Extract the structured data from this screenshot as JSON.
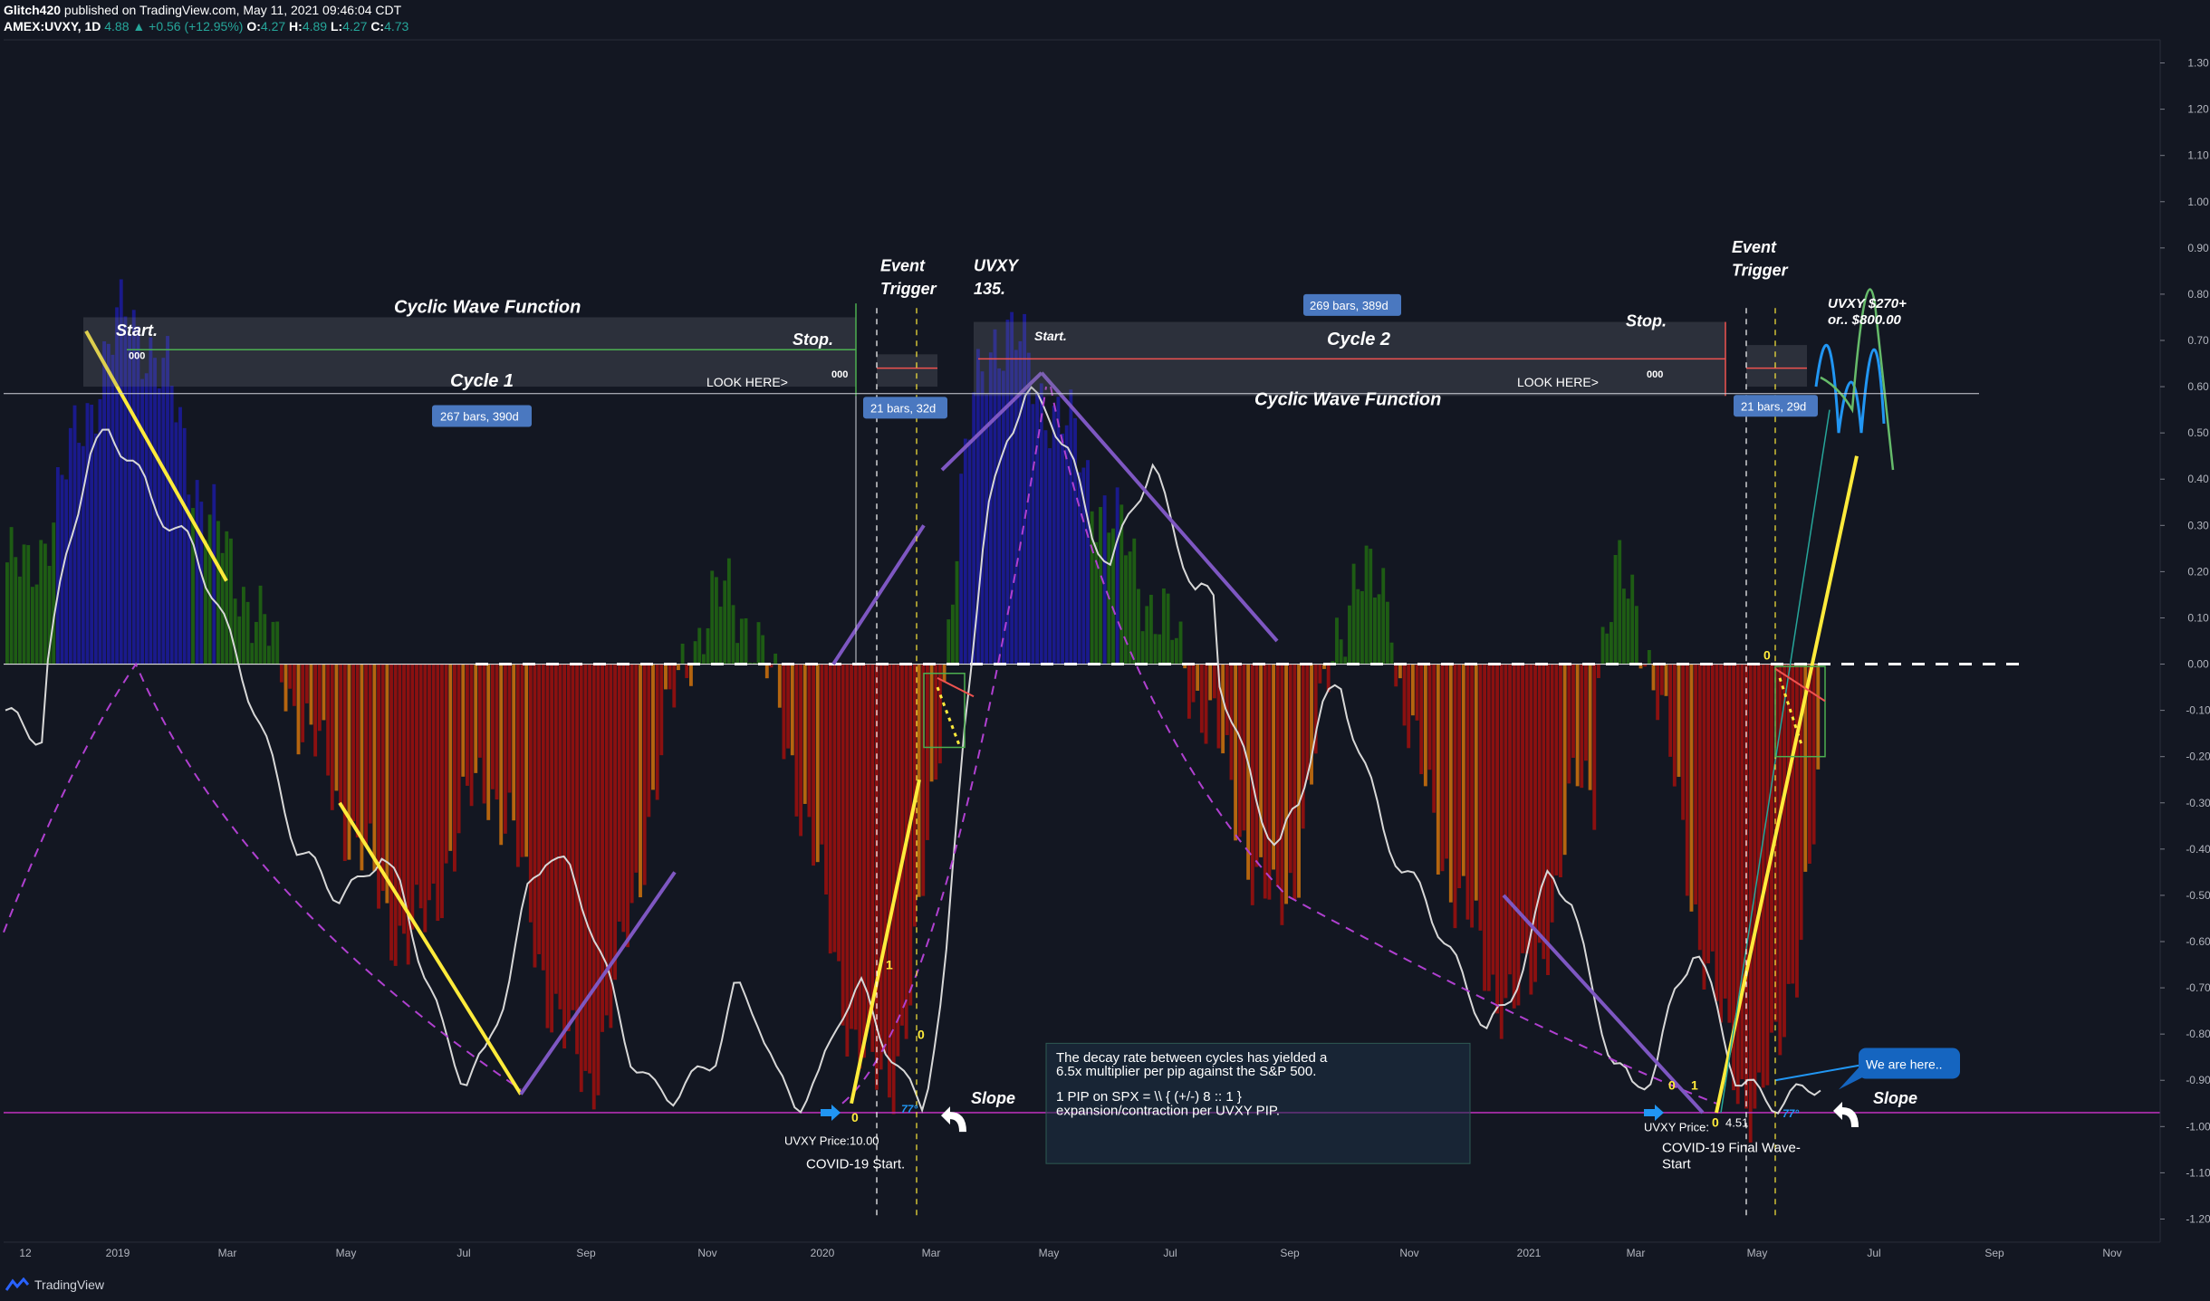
{
  "header": {
    "publisher": "Glitch420",
    "published_text": "published on TradingView.com, May 11, 2021 09:46:04 CDT",
    "symbol": "AMEX:UVXY, 1D",
    "last": "4.88",
    "change": "+0.56 (+12.95%)",
    "o_label": "O:",
    "o": "4.27",
    "h_label": "H:",
    "h": "4.89",
    "l_label": "L:",
    "l": "4.27",
    "c_label": "C:",
    "c": "4.73"
  },
  "footer": {
    "brand": "TradingView"
  },
  "colors": {
    "background": "#131722",
    "bull_strong": "#1a1a8c",
    "bull": "#1e5c14",
    "bear": "#8b1010",
    "bear_light": "#b5650f",
    "oscillator": "#d8d8d8",
    "trend_yellow": "#ffeb3b",
    "trend_purple": "#7e57c2",
    "arc_dashed": "#b040d0",
    "baseline": "#b32fb3",
    "label_blue": "#4a78c0"
  },
  "chart_data": {
    "type": "bar",
    "title": "",
    "ylim": [
      -1.25,
      1.35
    ],
    "y_ticks": [
      "1.30",
      "1.20",
      "1.10",
      "1.00",
      "0.90",
      "0.80",
      "0.70",
      "0.60",
      "0.50",
      "0.40",
      "0.30",
      "0.20",
      "0.10",
      "0.00",
      "-0.10",
      "-0.20",
      "-0.30",
      "-0.40",
      "-0.50",
      "-0.60",
      "-0.70",
      "-0.80",
      "-0.90",
      "-1.00",
      "-1.10",
      "-1.20"
    ],
    "x_ticks": [
      "12",
      "2019",
      "Mar",
      "May",
      "Jul",
      "Sep",
      "Nov",
      "2020",
      "Mar",
      "May",
      "Jul",
      "Sep",
      "Nov",
      "2021",
      "Mar",
      "May",
      "Jul",
      "Sep",
      "Nov"
    ],
    "series": [
      {
        "values": [
          0.22,
          0.18,
          0.3,
          0.42,
          0.55,
          0.68,
          0.75,
          0.7,
          0.6,
          0.45,
          0.32,
          0.22,
          0.15,
          0.05,
          -0.05,
          -0.15,
          -0.25,
          -0.35,
          -0.45,
          -0.55,
          -0.6,
          -0.55,
          -0.4,
          -0.3,
          -0.25,
          -0.35,
          -0.55,
          -0.72,
          -0.85,
          -0.9,
          -0.75,
          -0.55,
          -0.3,
          -0.1,
          0.05,
          0.12,
          0.15,
          0.08,
          -0.05,
          -0.2,
          -0.4,
          -0.6,
          -0.8,
          -0.9,
          -0.88,
          -0.7,
          -0.3,
          0.2,
          0.55,
          0.72,
          0.7,
          0.62,
          0.55,
          0.48,
          0.38,
          0.3,
          0.22,
          0.12,
          0.05,
          -0.05,
          -0.15,
          -0.3,
          -0.45,
          -0.55,
          -0.45,
          -0.2,
          0.05,
          0.2,
          0.15,
          0.0,
          -0.2,
          -0.35,
          -0.5,
          -0.6,
          -0.7,
          -0.75,
          -0.65,
          -0.5,
          -0.25,
          0.0,
          0.18,
          0.12,
          -0.05,
          -0.3,
          -0.55,
          -0.75,
          -0.9,
          -0.95,
          -0.85,
          -0.6,
          -0.3
        ]
      },
      {
        "values": [
          -0.1,
          -0.15,
          0.0,
          0.25,
          0.45,
          0.5,
          0.45,
          0.35,
          0.3,
          0.25,
          0.15,
          0.02,
          -0.1,
          -0.25,
          -0.4,
          -0.45,
          -0.5,
          -0.48,
          -0.4,
          -0.5,
          -0.65,
          -0.8,
          -0.9,
          -0.85,
          -0.7,
          -0.5,
          -0.4,
          -0.45,
          -0.55,
          -0.7,
          -0.85,
          -0.92,
          -0.93,
          -0.9,
          -0.85,
          -0.7,
          -0.75,
          -0.9,
          -0.95,
          -0.9,
          -0.75,
          -0.7,
          -0.8,
          -0.9,
          -0.95,
          -0.7,
          -0.1,
          0.3,
          0.5,
          0.58,
          0.55,
          0.45,
          0.3,
          0.2,
          0.35,
          0.42,
          0.3,
          0.15,
          0.0,
          -0.15,
          -0.3,
          -0.4,
          -0.3,
          -0.1,
          -0.05,
          -0.2,
          -0.35,
          -0.45,
          -0.5,
          -0.6,
          -0.7,
          -0.78,
          -0.75,
          -0.6,
          -0.45,
          -0.5,
          -0.7,
          -0.85,
          -0.92,
          -0.88,
          -0.72,
          -0.6,
          -0.75,
          -0.9,
          -0.93,
          -0.95,
          -0.93,
          -0.9
        ]
      }
    ],
    "annotations": {
      "start1": "Start.",
      "cycle_wave_1": "Cyclic Wave Function",
      "stop1": "Stop.",
      "cycle1": "Cycle 1",
      "look1": "LOOK HERE>",
      "bars1": "267 bars, 390d",
      "zero_a": "000",
      "zero_b": "000",
      "event1_l1": "Event",
      "event1_l2": "Trigger",
      "bars_e1": "21 bars, 32d",
      "uvxy135_l1": "UVXY",
      "uvxy135_l2": "135.",
      "bars2": "269 bars, 389d",
      "start2": "Start.",
      "cycle2": "Cycle 2",
      "stop2": "Stop.",
      "zero_c": "000",
      "look2": "LOOK HERE>",
      "cycle_wave_2": "Cyclic Wave Function",
      "event2_l1": "Event",
      "event2_l2": "Trigger",
      "bars_e2": "21 bars, 29d",
      "target_l1": "UVXY $270+",
      "target_l2": "or.. $800.00",
      "we_are_here": "We are here..",
      "slope1": "Slope",
      "slope2": "Slope",
      "deg1": "77°",
      "deg2": "77°",
      "price1": "UVXY Price:10.00",
      "covid_start": "COVID-19 Start.",
      "price2_label": "UVXY Price:",
      "price2_val": "4.51",
      "covid_final_l1": "COVID-19 Final Wave-",
      "covid_final_l2": "Start",
      "fib_0a": "0",
      "fib_1a": "1",
      "fib_0b": "0",
      "fib_0c": "0",
      "fib_1b": "1",
      "fib_0d": "0",
      "fib_0e": "0",
      "note_l1": "The decay rate between cycles has yielded a",
      "note_l2": "6.5x multiplier per pip against the S&P 500.",
      "note_l3": "1 PIP on SPX = \\\\  { (+/-)  8 :: 1 }",
      "note_l4": "expansion/contraction per UVXY PIP."
    }
  }
}
